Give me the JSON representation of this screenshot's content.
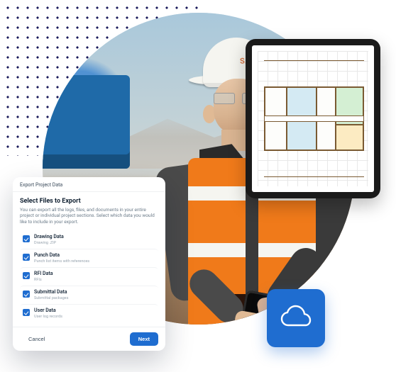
{
  "hardhat_text": "SAM",
  "dialog": {
    "header": "Export Project Data",
    "title": "Select Files to Export",
    "description": "You can export all the logs, files, and documents in your entire project or individual project sections. Select which data you would like to include in your export.",
    "options": [
      {
        "label": "Drawing Data",
        "sub": "Drawing .ZIP"
      },
      {
        "label": "Punch Data",
        "sub": "Punch list items with references"
      },
      {
        "label": "RFI Data",
        "sub": "RFIs"
      },
      {
        "label": "Submittal Data",
        "sub": "Submittal packages"
      },
      {
        "label": "User Data",
        "sub": "User log records"
      }
    ],
    "cancel": "Cancel",
    "next": "Next"
  },
  "cloud_tile": {
    "icon": "cloud-icon",
    "color": "#1f6dd0"
  },
  "tablet": {
    "content": "floor-plan"
  }
}
